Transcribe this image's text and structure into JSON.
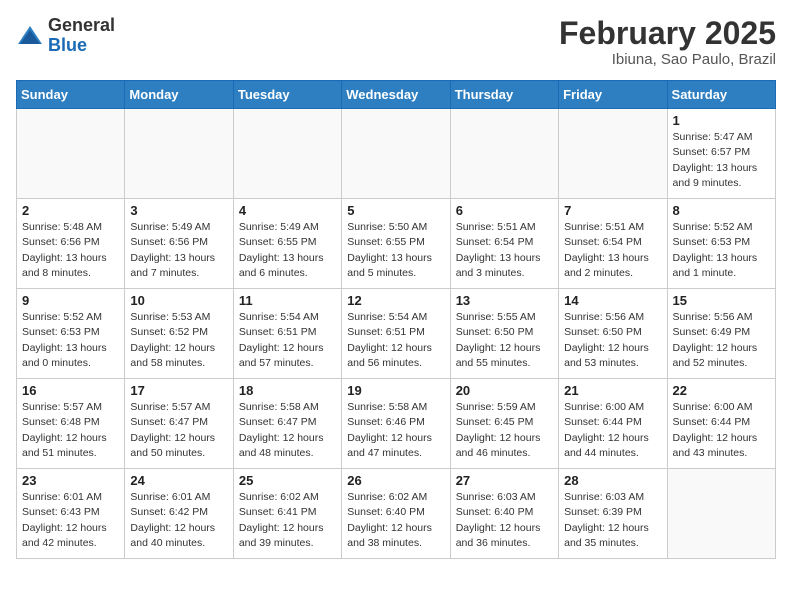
{
  "header": {
    "logo_general": "General",
    "logo_blue": "Blue",
    "month_title": "February 2025",
    "location": "Ibiuna, Sao Paulo, Brazil"
  },
  "calendar": {
    "weekdays": [
      "Sunday",
      "Monday",
      "Tuesday",
      "Wednesday",
      "Thursday",
      "Friday",
      "Saturday"
    ],
    "weeks": [
      [
        {
          "day": "",
          "info": ""
        },
        {
          "day": "",
          "info": ""
        },
        {
          "day": "",
          "info": ""
        },
        {
          "day": "",
          "info": ""
        },
        {
          "day": "",
          "info": ""
        },
        {
          "day": "",
          "info": ""
        },
        {
          "day": "1",
          "info": "Sunrise: 5:47 AM\nSunset: 6:57 PM\nDaylight: 13 hours and 9 minutes."
        }
      ],
      [
        {
          "day": "2",
          "info": "Sunrise: 5:48 AM\nSunset: 6:56 PM\nDaylight: 13 hours and 8 minutes."
        },
        {
          "day": "3",
          "info": "Sunrise: 5:49 AM\nSunset: 6:56 PM\nDaylight: 13 hours and 7 minutes."
        },
        {
          "day": "4",
          "info": "Sunrise: 5:49 AM\nSunset: 6:55 PM\nDaylight: 13 hours and 6 minutes."
        },
        {
          "day": "5",
          "info": "Sunrise: 5:50 AM\nSunset: 6:55 PM\nDaylight: 13 hours and 5 minutes."
        },
        {
          "day": "6",
          "info": "Sunrise: 5:51 AM\nSunset: 6:54 PM\nDaylight: 13 hours and 3 minutes."
        },
        {
          "day": "7",
          "info": "Sunrise: 5:51 AM\nSunset: 6:54 PM\nDaylight: 13 hours and 2 minutes."
        },
        {
          "day": "8",
          "info": "Sunrise: 5:52 AM\nSunset: 6:53 PM\nDaylight: 13 hours and 1 minute."
        }
      ],
      [
        {
          "day": "9",
          "info": "Sunrise: 5:52 AM\nSunset: 6:53 PM\nDaylight: 13 hours and 0 minutes."
        },
        {
          "day": "10",
          "info": "Sunrise: 5:53 AM\nSunset: 6:52 PM\nDaylight: 12 hours and 58 minutes."
        },
        {
          "day": "11",
          "info": "Sunrise: 5:54 AM\nSunset: 6:51 PM\nDaylight: 12 hours and 57 minutes."
        },
        {
          "day": "12",
          "info": "Sunrise: 5:54 AM\nSunset: 6:51 PM\nDaylight: 12 hours and 56 minutes."
        },
        {
          "day": "13",
          "info": "Sunrise: 5:55 AM\nSunset: 6:50 PM\nDaylight: 12 hours and 55 minutes."
        },
        {
          "day": "14",
          "info": "Sunrise: 5:56 AM\nSunset: 6:50 PM\nDaylight: 12 hours and 53 minutes."
        },
        {
          "day": "15",
          "info": "Sunrise: 5:56 AM\nSunset: 6:49 PM\nDaylight: 12 hours and 52 minutes."
        }
      ],
      [
        {
          "day": "16",
          "info": "Sunrise: 5:57 AM\nSunset: 6:48 PM\nDaylight: 12 hours and 51 minutes."
        },
        {
          "day": "17",
          "info": "Sunrise: 5:57 AM\nSunset: 6:47 PM\nDaylight: 12 hours and 50 minutes."
        },
        {
          "day": "18",
          "info": "Sunrise: 5:58 AM\nSunset: 6:47 PM\nDaylight: 12 hours and 48 minutes."
        },
        {
          "day": "19",
          "info": "Sunrise: 5:58 AM\nSunset: 6:46 PM\nDaylight: 12 hours and 47 minutes."
        },
        {
          "day": "20",
          "info": "Sunrise: 5:59 AM\nSunset: 6:45 PM\nDaylight: 12 hours and 46 minutes."
        },
        {
          "day": "21",
          "info": "Sunrise: 6:00 AM\nSunset: 6:44 PM\nDaylight: 12 hours and 44 minutes."
        },
        {
          "day": "22",
          "info": "Sunrise: 6:00 AM\nSunset: 6:44 PM\nDaylight: 12 hours and 43 minutes."
        }
      ],
      [
        {
          "day": "23",
          "info": "Sunrise: 6:01 AM\nSunset: 6:43 PM\nDaylight: 12 hours and 42 minutes."
        },
        {
          "day": "24",
          "info": "Sunrise: 6:01 AM\nSunset: 6:42 PM\nDaylight: 12 hours and 40 minutes."
        },
        {
          "day": "25",
          "info": "Sunrise: 6:02 AM\nSunset: 6:41 PM\nDaylight: 12 hours and 39 minutes."
        },
        {
          "day": "26",
          "info": "Sunrise: 6:02 AM\nSunset: 6:40 PM\nDaylight: 12 hours and 38 minutes."
        },
        {
          "day": "27",
          "info": "Sunrise: 6:03 AM\nSunset: 6:40 PM\nDaylight: 12 hours and 36 minutes."
        },
        {
          "day": "28",
          "info": "Sunrise: 6:03 AM\nSunset: 6:39 PM\nDaylight: 12 hours and 35 minutes."
        },
        {
          "day": "",
          "info": ""
        }
      ]
    ]
  }
}
